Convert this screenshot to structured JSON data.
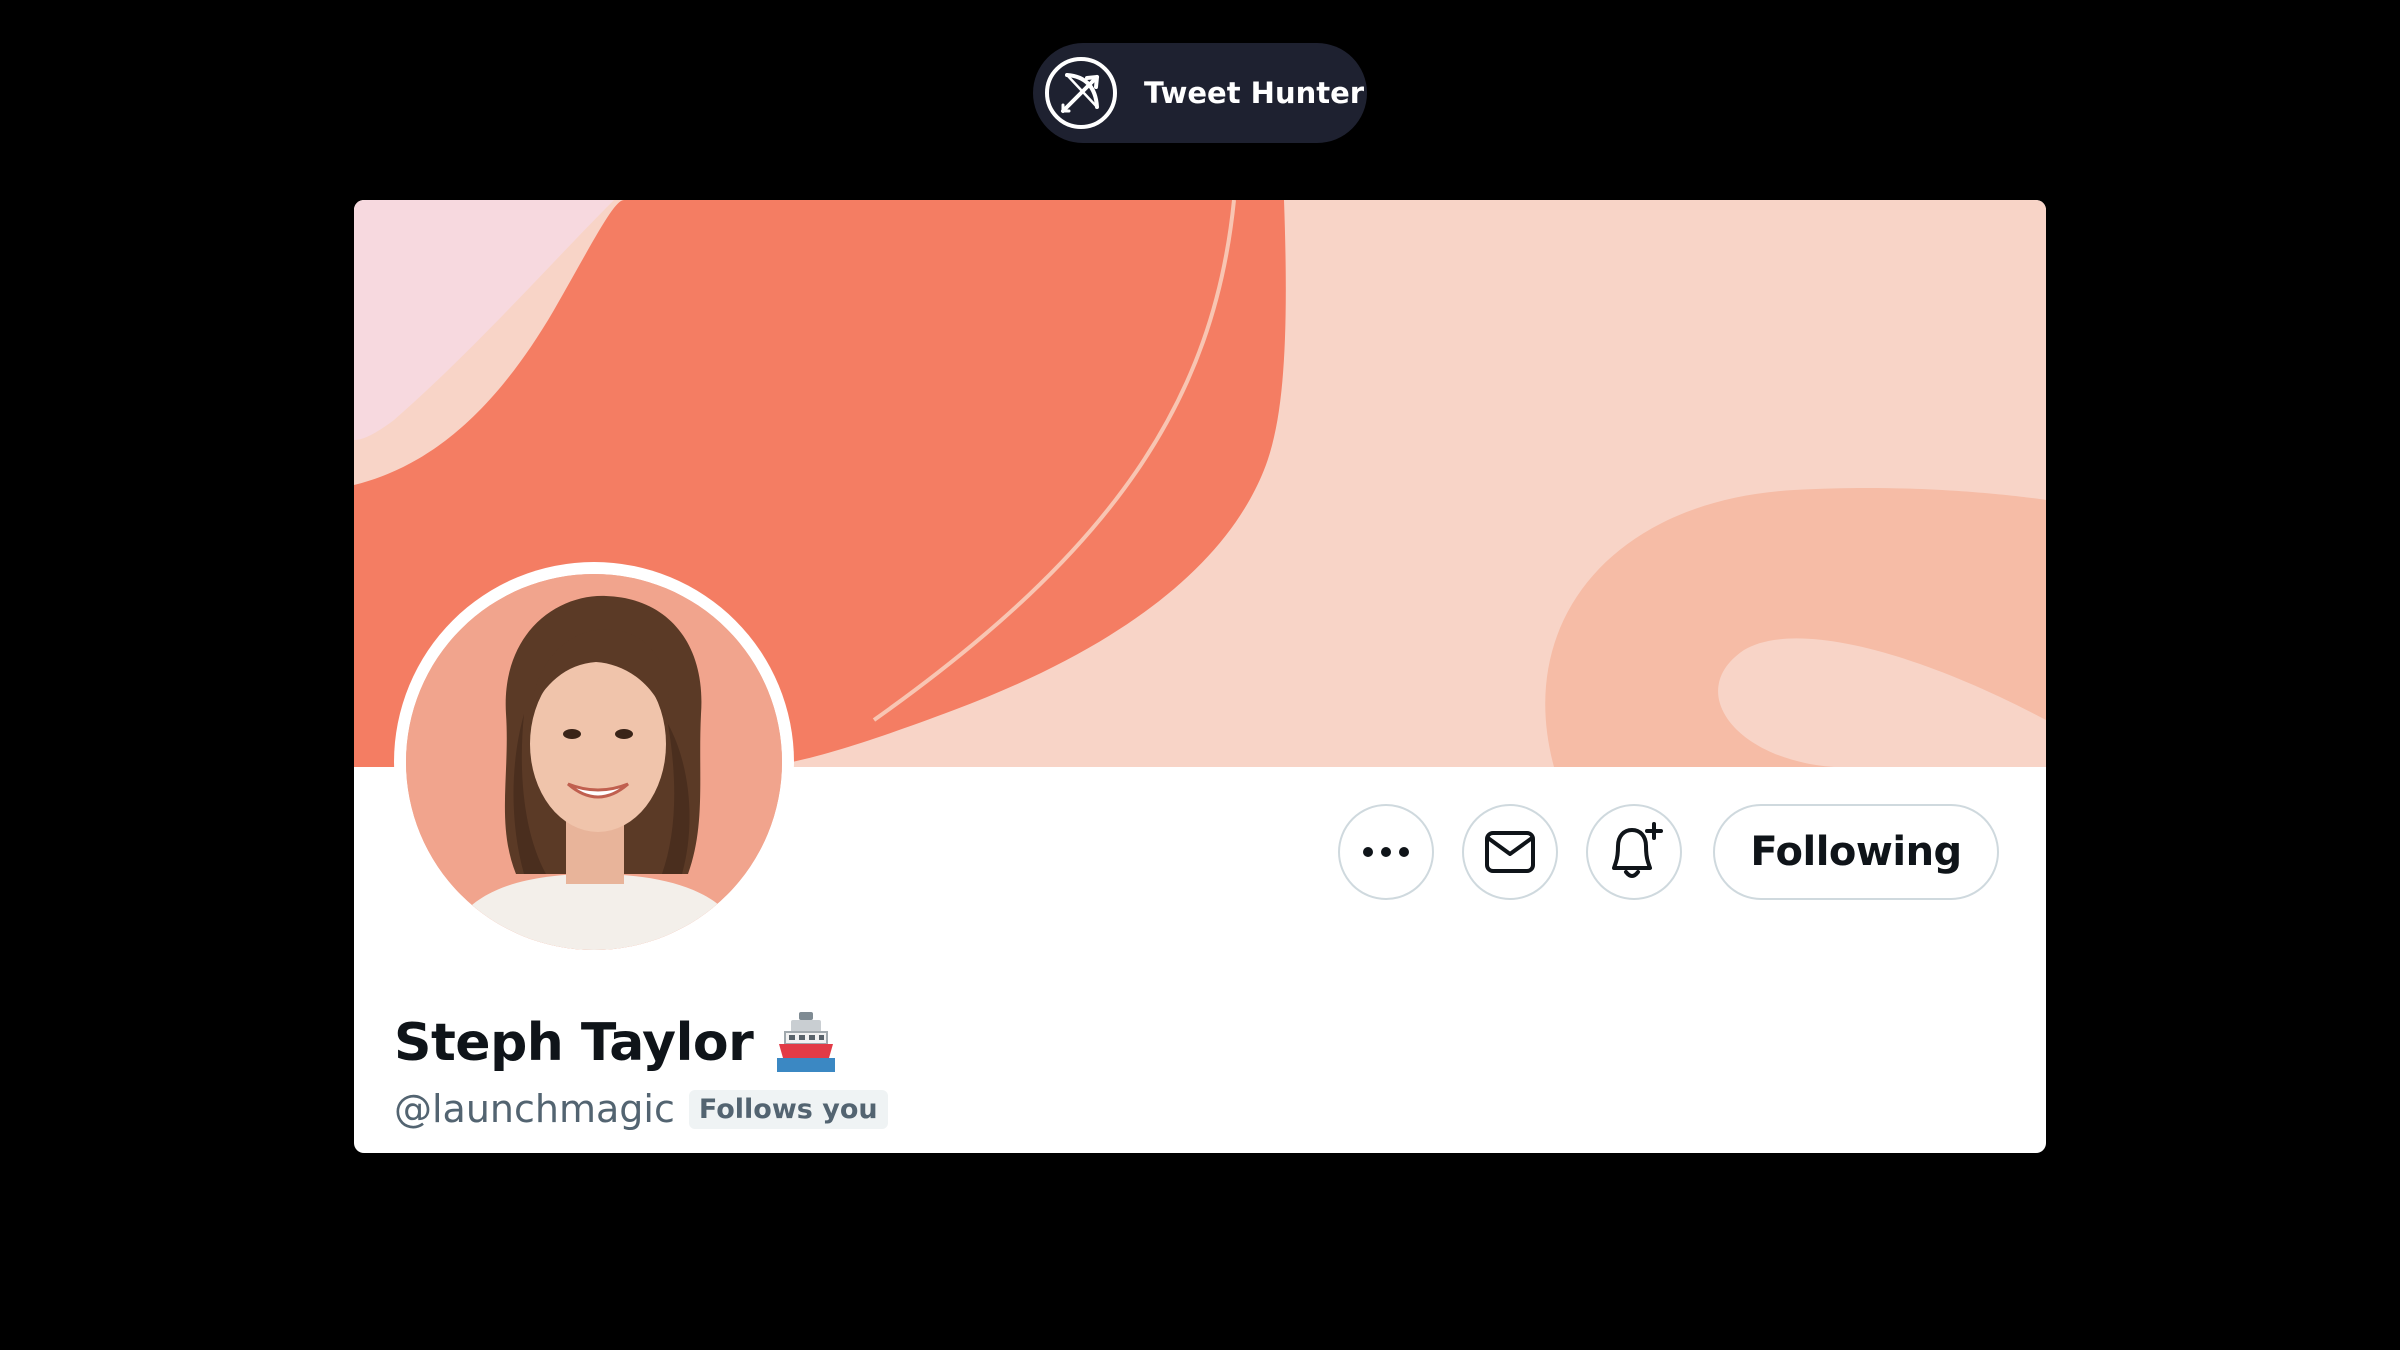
{
  "brand": {
    "name": "Tweet Hunter",
    "logo_icon": "bow-and-arrow-icon"
  },
  "profile": {
    "display_name": "Steph Taylor",
    "name_emoji": "ship-emoji",
    "handle": "@launchmagic",
    "follows_you_label": "Follows you",
    "following_label": "Following"
  },
  "actions": {
    "more_icon": "more-icon",
    "message_icon": "mail-icon",
    "notify_icon": "bell-plus-icon"
  },
  "colors": {
    "page_background": "#000000",
    "banner_light": "#f8d4c7",
    "banner_coral": "#f47d63",
    "banner_pink": "#f7d9df",
    "text_primary": "#0f1419",
    "text_secondary": "#536471",
    "button_border": "#cfd9de"
  }
}
